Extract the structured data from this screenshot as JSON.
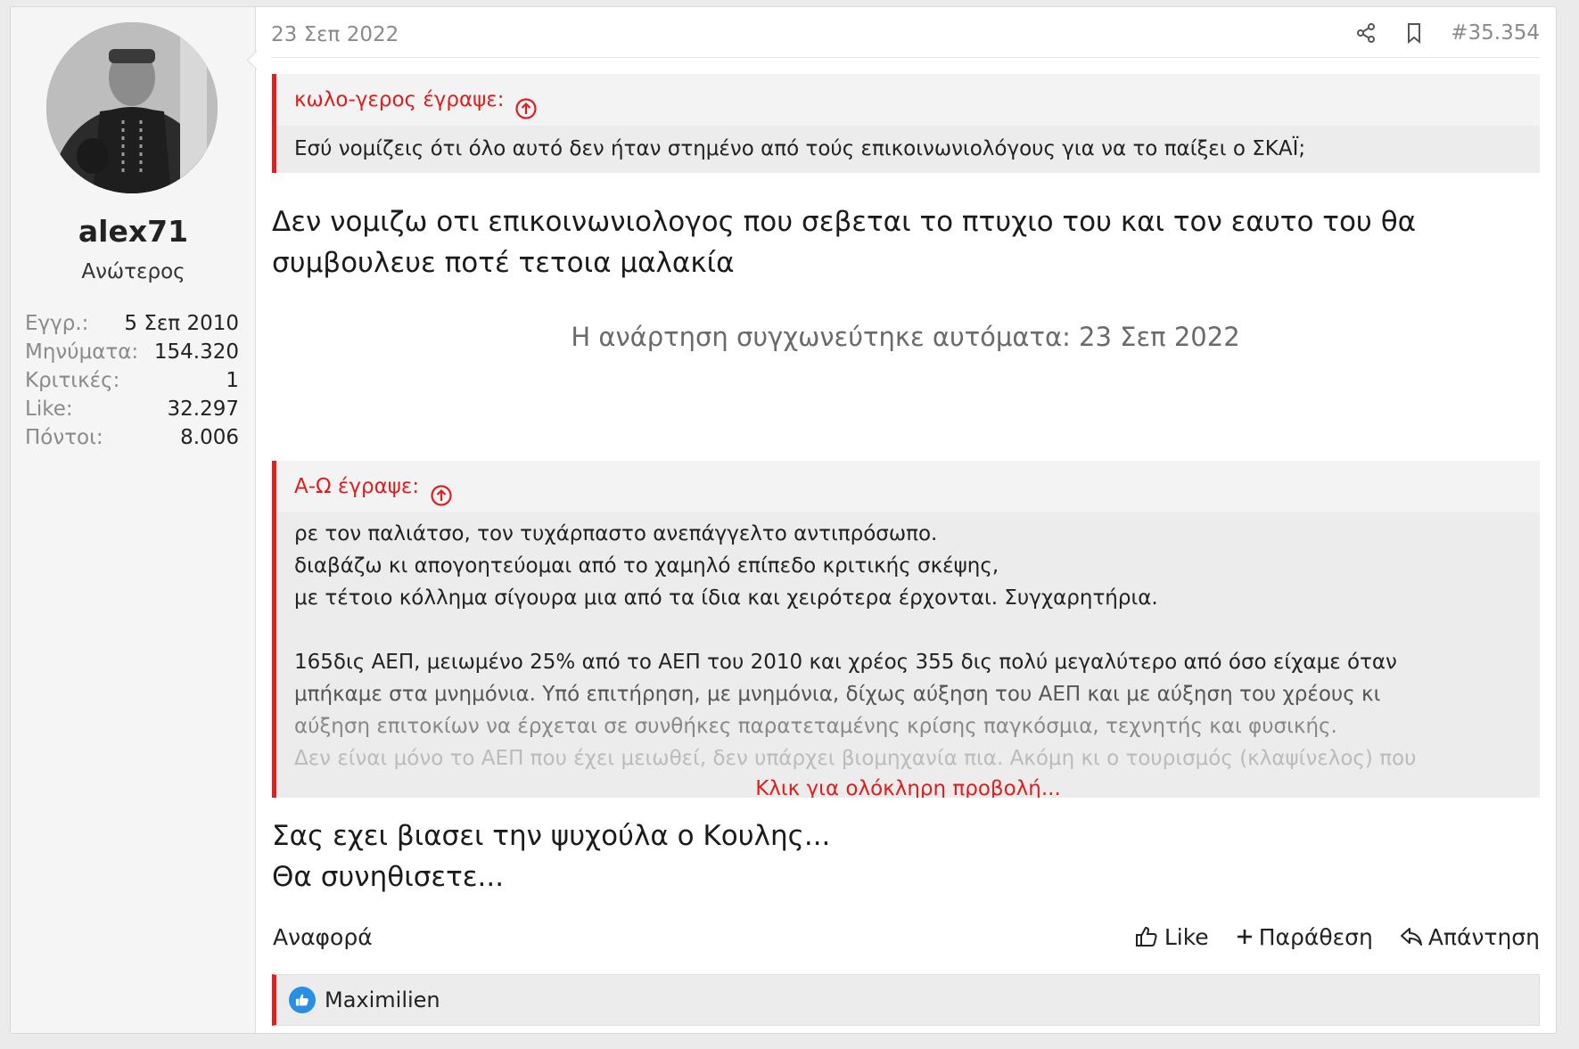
{
  "user": {
    "avatar_icon": "avatar-photo",
    "name": "alex71",
    "title": "Ανώτερος",
    "stats": [
      {
        "label": "Εγγρ.:",
        "value": "5 Σεπ 2010"
      },
      {
        "label": "Μηνύματα:",
        "value": "154.320"
      },
      {
        "label": "Κριτικές:",
        "value": "1"
      },
      {
        "label": "Like:",
        "value": "32.297"
      },
      {
        "label": "Πόντοι:",
        "value": "8.006"
      }
    ]
  },
  "post": {
    "date": "23 Σεπ 2022",
    "share_icon": "share-icon",
    "bookmark_icon": "bookmark-icon",
    "number": "#35.354",
    "quote1": {
      "author": "κωλο-γερος έγραψε:",
      "text": "Εσύ νομίζεις ότι όλο αυτό δεν ήταν στημένο από τούς επικοινωνιολόγους για να το παίξει ο ΣΚΑΪ;"
    },
    "reply1": [
      "Δεν νομιζω οτι επικοινωνιολογος που σεβεται το πτυχιο του και τον εαυτο του θα",
      "συμβουλευε ποτέ τετοια μαλακία"
    ],
    "merged_notice": "Η ανάρτηση συγχωνεύτηκε αυτόματα: 23 Σεπ 2022",
    "quote2": {
      "author": "Α-Ω έγραψε:",
      "lines": [
        "ρε τον παλιάτσο, τον τυχάρπαστο ανεπάγγελτο αντιπρόσωπο.",
        "διαβάζω κι απογοητεύομαι από το χαμηλό επίπεδο κριτικής σκέψης,",
        "με τέτοιο κόλλημα σίγουρα μια από τα ίδια και χειρότερα έρχονται. Συγχαρητήρια.",
        "",
        "165δις ΑΕΠ, μειωμένο 25% από το ΑΕΠ του 2010 και χρέος 355 δις πολύ μεγαλύτερο από όσο είχαμε όταν",
        "μπήκαμε στα μνημόνια. Υπό επιτήρηση, με μνημόνια, δίχως αύξηση του ΑΕΠ και με αύξηση του χρέους κι",
        "αύξηση επιτοκίων να έρχεται σε συνθήκες παρατεταμένης κρίσης παγκόσμια, τεχνητής και φυσικής.",
        "Δεν είναι μόνο το ΑΕΠ που έχει μειωθεί, δεν υπάρχει βιομηχανία πια. Ακόμη κι ο τουρισμός (κλαψίνελος) που"
      ],
      "expand_label": "Κλικ για ολόκληρη προβολή..."
    },
    "reply2": [
      "Σας εχει βιασει την ψυχούλα ο Κουλης...",
      "Θα συνηθισετε..."
    ],
    "footer": {
      "report": "Αναφορά",
      "like": "Like",
      "quote": "Παράθεση",
      "reply": "Απάντηση"
    },
    "likes": {
      "icon": "thumbs-up-icon",
      "names": "Maximilien"
    }
  },
  "colors": {
    "accent": "#e02020",
    "like_badge": "#2a8fe3"
  }
}
